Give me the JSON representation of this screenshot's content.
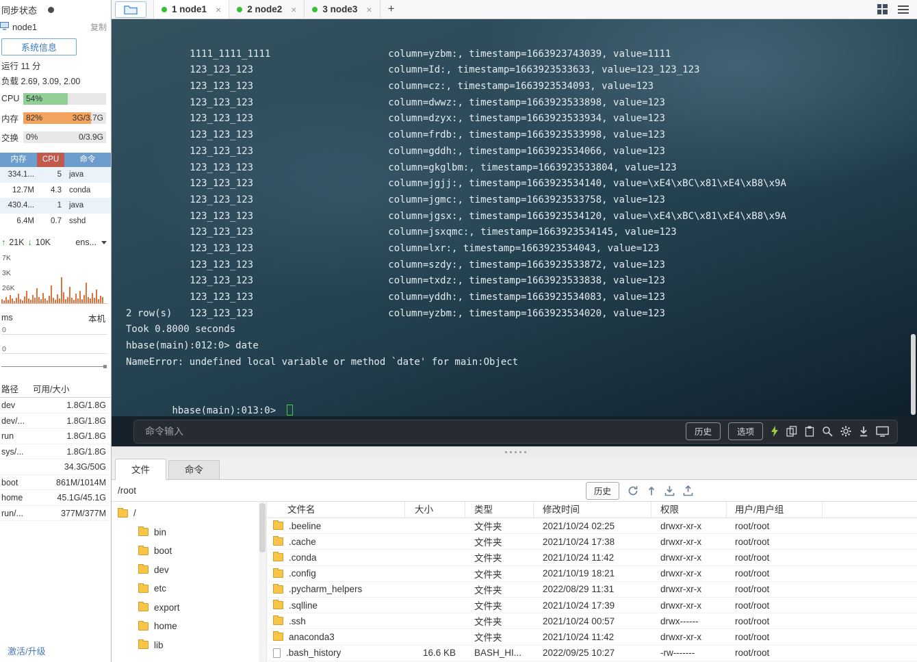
{
  "colors": {
    "accent_blue": "#3a7abf",
    "cpu_bar_green": "#90cf95",
    "mem_bar_orange": "#f2a35e",
    "net_bar_orange": "#e0713a",
    "connected_dot_green": "#33c133",
    "folder_yellow": "#f8c548",
    "terminal_bg": "#23404f"
  },
  "sidebar": {
    "sync_label": "同步状态",
    "node_name": "node1",
    "copy_label": "复制",
    "sysinfo_label": "系统信息",
    "uptime_label": "运行 11 分",
    "load_label": "负载 2.69, 3.09, 2.00",
    "meters": {
      "cpu": {
        "label": "CPU",
        "percent_text": "54%",
        "percent": 54,
        "detail": ""
      },
      "mem": {
        "label": "内存",
        "percent_text": "82%",
        "percent": 82,
        "detail": "3G/3.7G"
      },
      "swap": {
        "label": "交换",
        "percent_text": "0%",
        "percent": 0,
        "detail": "0/3.9G"
      }
    },
    "process_table": {
      "headers": [
        "内存",
        "CPU",
        "命令"
      ],
      "rows": [
        [
          "334.1...",
          "5",
          "java"
        ],
        [
          "12.7M",
          "4.3",
          "conda"
        ],
        [
          "430.4...",
          "1",
          "java"
        ],
        [
          "6.4M",
          "0.7",
          "sshd"
        ]
      ]
    },
    "network": {
      "up_arrow": "↑",
      "up_value": "21K",
      "down_arrow": "↓",
      "down_value": "10K",
      "iface_label": "ens...",
      "scale_labels": [
        "7K",
        "3K",
        "26K"
      ],
      "bars": [
        6,
        4,
        9,
        5,
        12,
        7,
        3,
        8,
        14,
        6,
        4,
        10,
        18,
        7,
        5,
        12,
        8,
        22,
        9,
        6,
        15,
        7,
        4,
        11,
        26,
        8,
        5,
        13,
        7,
        38,
        16,
        6,
        9,
        24,
        8,
        5,
        14,
        7,
        18,
        6,
        12,
        30,
        9,
        7,
        15,
        8,
        20,
        6,
        11,
        9
      ]
    },
    "ping": {
      "unit_label": "ms",
      "target_label": "本机",
      "scale_labels": [
        "0",
        "0"
      ]
    },
    "disk_table": {
      "headers": [
        "路径",
        "可用/大小"
      ],
      "rows": [
        [
          "dev",
          "1.8G/1.8G"
        ],
        [
          "dev/...",
          "1.8G/1.8G"
        ],
        [
          "run",
          "1.8G/1.8G"
        ],
        [
          "sys/...",
          "1.8G/1.8G"
        ],
        [
          "",
          "34.3G/50G"
        ],
        [
          "boot",
          "861M/1014M"
        ],
        [
          "home",
          "45.1G/45.1G"
        ],
        [
          "run/...",
          "377M/377M"
        ]
      ]
    },
    "activate_label": "激活/升级"
  },
  "tabbar": {
    "tabs": [
      {
        "label": "1 node1",
        "state": "active",
        "close": "×"
      },
      {
        "label": "2 node2",
        "state": "inactive",
        "close": "×"
      },
      {
        "label": "3 node3",
        "state": "inactive",
        "close": "×"
      }
    ],
    "new_tab_label": "+",
    "right_icons": [
      "grid-view-icon",
      "menu-icon"
    ]
  },
  "terminal": {
    "scan_rows": [
      {
        "key": "1111_1111_1111",
        "detail": "column=yzbm:, timestamp=1663923743039, value=1111"
      },
      {
        "key": "123_123_123",
        "detail": "column=Id:, timestamp=1663923533633, value=123_123_123"
      },
      {
        "key": "123_123_123",
        "detail": "column=cz:, timestamp=1663923534093, value=123"
      },
      {
        "key": "123_123_123",
        "detail": "column=dwwz:, timestamp=1663923533898, value=123"
      },
      {
        "key": "123_123_123",
        "detail": "column=dzyx:, timestamp=1663923533934, value=123"
      },
      {
        "key": "123_123_123",
        "detail": "column=frdb:, timestamp=1663923533998, value=123"
      },
      {
        "key": "123_123_123",
        "detail": "column=gddh:, timestamp=1663923534066, value=123"
      },
      {
        "key": "123_123_123",
        "detail": "column=gkglbm:, timestamp=1663923533804, value=123"
      },
      {
        "key": "123_123_123",
        "detail": "column=jgjj:, timestamp=1663923534140, value=\\xE4\\xBC\\x81\\xE4\\xB8\\x9A"
      },
      {
        "key": "123_123_123",
        "detail": "column=jgmc:, timestamp=1663923533758, value=123"
      },
      {
        "key": "123_123_123",
        "detail": "column=jgsx:, timestamp=1663923534120, value=\\xE4\\xBC\\x81\\xE4\\xB8\\x9A"
      },
      {
        "key": "123_123_123",
        "detail": "column=jsxqmc:, timestamp=1663923534145, value=123"
      },
      {
        "key": "123_123_123",
        "detail": "column=lxr:, timestamp=1663923534043, value=123"
      },
      {
        "key": "123_123_123",
        "detail": "column=szdy:, timestamp=1663923533872, value=123"
      },
      {
        "key": "123_123_123",
        "detail": "column=txdz:, timestamp=1663923533838, value=123"
      },
      {
        "key": "123_123_123",
        "detail": "column=yddh:, timestamp=1663923534083, value=123"
      },
      {
        "key": "123_123_123",
        "detail": "column=yzbm:, timestamp=1663923534020, value=123"
      }
    ],
    "tail_lines": [
      "2 row(s)",
      "Took 0.8000 seconds",
      "hbase(main):012:0> date",
      "NameError: undefined local variable or method `date' for main:Object",
      ""
    ],
    "prompt": "hbase(main):013:0> "
  },
  "cmdbar": {
    "placeholder": "命令输入",
    "history_label": "历史",
    "options_label": "选项",
    "icons": [
      "lightning-icon",
      "copy-icon",
      "paste-icon",
      "search-icon",
      "gear-icon",
      "download-icon",
      "screen-icon"
    ]
  },
  "filepanel": {
    "tab_files": "文件",
    "tab_commands": "命令",
    "path": "/root",
    "history_label": "历史",
    "toolbar_icons": [
      "refresh-icon",
      "transfer-icon",
      "download-tray-icon",
      "upload-tray-icon"
    ],
    "tree_root": "/",
    "tree_items": [
      "bin",
      "boot",
      "dev",
      "etc",
      "export",
      "home",
      "lib"
    ],
    "table_headers": [
      "文件名",
      "大小",
      "类型",
      "修改时间",
      "权限",
      "用户/用户组"
    ],
    "files": [
      {
        "icon": "folder",
        "name": ".beeline",
        "size": "",
        "type": "文件夹",
        "mtime": "2021/10/24 02:25",
        "perm": "drwxr-xr-x",
        "owner": "root/root"
      },
      {
        "icon": "folder",
        "name": ".cache",
        "size": "",
        "type": "文件夹",
        "mtime": "2021/10/24 17:38",
        "perm": "drwxr-xr-x",
        "owner": "root/root"
      },
      {
        "icon": "folder",
        "name": ".conda",
        "size": "",
        "type": "文件夹",
        "mtime": "2021/10/24 11:42",
        "perm": "drwxr-xr-x",
        "owner": "root/root"
      },
      {
        "icon": "folder",
        "name": ".config",
        "size": "",
        "type": "文件夹",
        "mtime": "2021/10/19 18:21",
        "perm": "drwxr-xr-x",
        "owner": "root/root"
      },
      {
        "icon": "folder",
        "name": ".pycharm_helpers",
        "size": "",
        "type": "文件夹",
        "mtime": "2022/08/29 11:31",
        "perm": "drwxr-xr-x",
        "owner": "root/root"
      },
      {
        "icon": "folder",
        "name": ".sqlline",
        "size": "",
        "type": "文件夹",
        "mtime": "2021/10/24 17:39",
        "perm": "drwxr-xr-x",
        "owner": "root/root"
      },
      {
        "icon": "folder",
        "name": ".ssh",
        "size": "",
        "type": "文件夹",
        "mtime": "2021/10/24 00:57",
        "perm": "drwx------",
        "owner": "root/root"
      },
      {
        "icon": "folder",
        "name": "anaconda3",
        "size": "",
        "type": "文件夹",
        "mtime": "2021/10/24 11:42",
        "perm": "drwxr-xr-x",
        "owner": "root/root"
      },
      {
        "icon": "file",
        "name": ".bash_history",
        "size": "16.6 KB",
        "type": "BASH_HI...",
        "mtime": "2022/09/25 10:27",
        "perm": "-rw-------",
        "owner": "root/root"
      }
    ]
  }
}
